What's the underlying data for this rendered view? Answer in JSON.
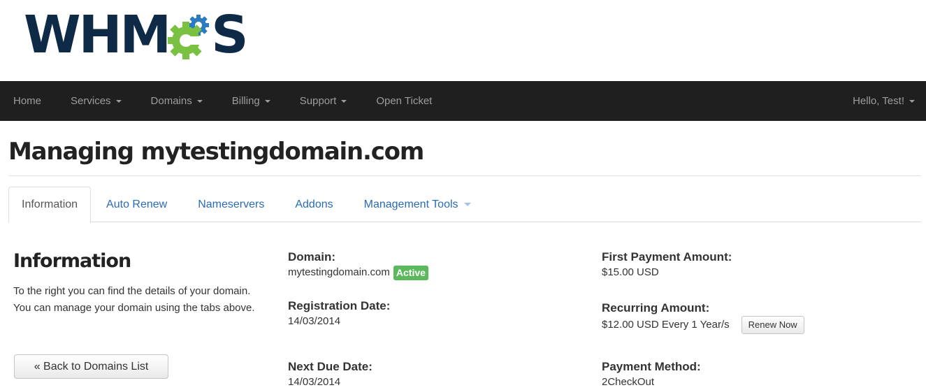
{
  "brand": {
    "logo_text_left": "WHM",
    "logo_text_right": "S",
    "logo_gear_letter": "C",
    "colors": {
      "navy": "#0e2a47",
      "gear_green": "#7ac142"
    }
  },
  "navbar": {
    "items": [
      {
        "label": "Home",
        "dropdown": false
      },
      {
        "label": "Services",
        "dropdown": true
      },
      {
        "label": "Domains",
        "dropdown": true
      },
      {
        "label": "Billing",
        "dropdown": true
      },
      {
        "label": "Support",
        "dropdown": true
      },
      {
        "label": "Open Ticket",
        "dropdown": false
      }
    ],
    "user_greeting": "Hello, Test!"
  },
  "page": {
    "title": "Managing mytestingdomain.com"
  },
  "tabs": [
    {
      "label": "Information",
      "active": true
    },
    {
      "label": "Auto Renew",
      "active": false
    },
    {
      "label": "Nameservers",
      "active": false
    },
    {
      "label": "Addons",
      "active": false
    },
    {
      "label": "Management Tools",
      "active": false,
      "dropdown": true
    }
  ],
  "info": {
    "heading": "Information",
    "description": "To the right you can find the details of your domain. You can manage your domain using the tabs above.",
    "back_button": "« Back to Domains List"
  },
  "details": {
    "domain": {
      "label": "Domain:",
      "value": "mytestingdomain.com",
      "status": "Active"
    },
    "registration_date": {
      "label": "Registration Date:",
      "value": "14/03/2014"
    },
    "next_due_date": {
      "label": "Next Due Date:",
      "value": "14/03/2014"
    },
    "first_payment": {
      "label": "First Payment Amount:",
      "value": "$15.00 USD"
    },
    "recurring_amount": {
      "label": "Recurring Amount:",
      "value": "$12.00 USD Every 1 Year/s",
      "renew_button": "Renew Now"
    },
    "payment_method": {
      "label": "Payment Method:",
      "value": "2CheckOut"
    }
  }
}
